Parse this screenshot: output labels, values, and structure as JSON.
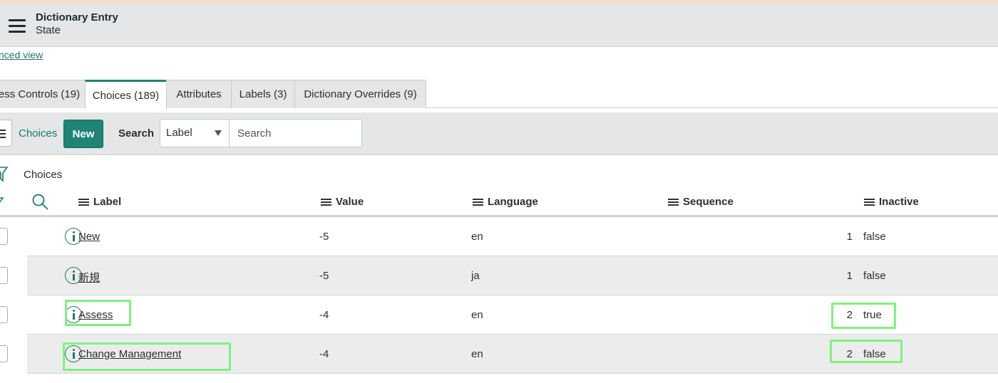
{
  "header": {
    "title": "Dictionary Entry",
    "subtitle": "State"
  },
  "advanced_link": "nced view",
  "tabs": [
    {
      "label": "ess Controls (19)"
    },
    {
      "label": "Choices (189)"
    },
    {
      "label": "Attributes"
    },
    {
      "label": "Labels (3)"
    },
    {
      "label": "Dictionary Overrides (9)"
    }
  ],
  "toolbar": {
    "list_label": "Choices",
    "new_label": "New",
    "search_label": "Search",
    "field_selected": "Label",
    "search_placeholder": "Search"
  },
  "breadcrumb": "Choices",
  "columns": {
    "label": "Label",
    "value": "Value",
    "language": "Language",
    "sequence": "Sequence",
    "inactive": "Inactive"
  },
  "rows": [
    {
      "label": "New",
      "value": "-5",
      "language": "en",
      "sequence": "1",
      "inactive": "false"
    },
    {
      "label": "新規",
      "value": "-5",
      "language": "ja",
      "sequence": "1",
      "inactive": "false"
    },
    {
      "label": "Assess",
      "value": "-4",
      "language": "en",
      "sequence": "2",
      "inactive": "true"
    },
    {
      "label": "Change Management",
      "value": "-4",
      "language": "en",
      "sequence": "2",
      "inactive": "false"
    }
  ],
  "colors": {
    "accent": "#1f8476",
    "highlight": "#7ef27a",
    "header_bg": "#e4e6e7"
  }
}
